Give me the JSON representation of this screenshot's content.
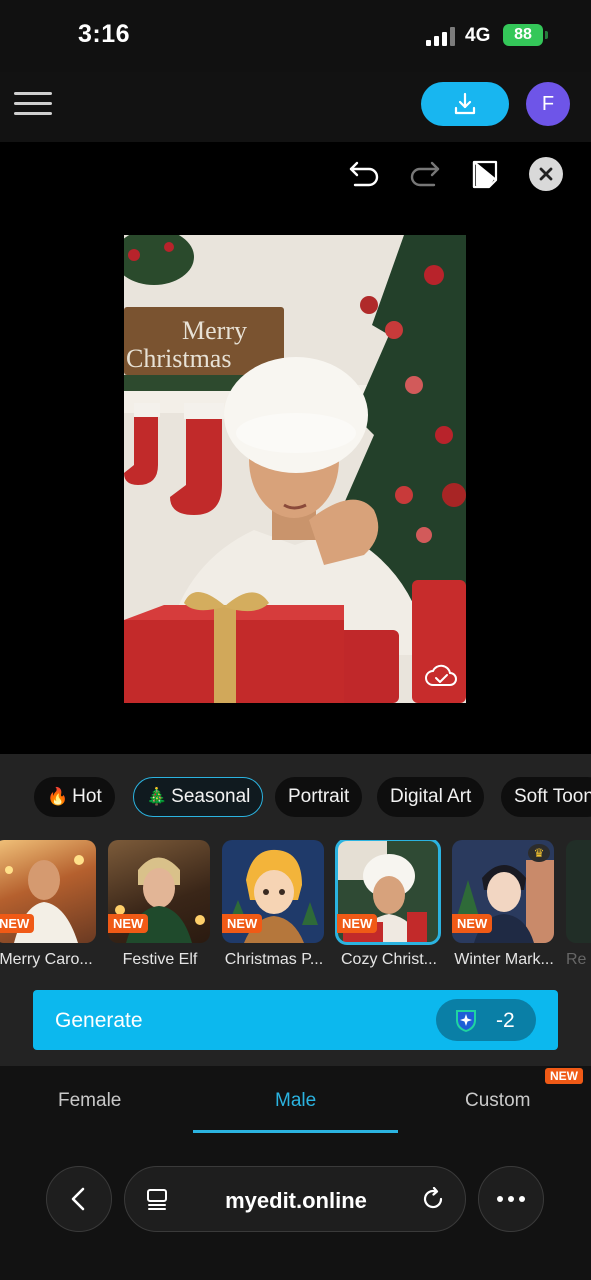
{
  "status_bar": {
    "time": "3:16",
    "network": "4G",
    "battery": "88"
  },
  "header": {
    "download_icon": "download-icon",
    "avatar_letter": "F",
    "colors": {
      "download": "#18b6f0",
      "avatar": "#6e55e8"
    }
  },
  "editor": {
    "tools": [
      "undo-icon",
      "redo-icon",
      "eraser-icon",
      "close-icon"
    ],
    "canvas_text": "Merry Christmas"
  },
  "categories": [
    {
      "emoji": "🔥",
      "label": "Hot"
    },
    {
      "emoji": "🎄",
      "label": "Seasonal",
      "active": true
    },
    {
      "emoji": "",
      "label": "Portrait"
    },
    {
      "emoji": "",
      "label": "Digital Art"
    },
    {
      "emoji": "",
      "label": "Soft Toon"
    }
  ],
  "styles": [
    {
      "label": "Merry Caro...",
      "badge": "NEW"
    },
    {
      "label": "Festive Elf",
      "badge": "NEW"
    },
    {
      "label": "Christmas P...",
      "badge": "NEW"
    },
    {
      "label": "Cozy Christ...",
      "badge": "NEW",
      "selected": true
    },
    {
      "label": "Winter Mark...",
      "badge": "NEW",
      "crown": "♛"
    },
    {
      "label": "Re",
      "badge": ""
    }
  ],
  "generate": {
    "label": "Generate",
    "cost": "-2",
    "cost_icon": "credit-shield-icon"
  },
  "gender_tabs": [
    {
      "label": "Female"
    },
    {
      "label": "Male",
      "active": true
    },
    {
      "label": "Custom",
      "tag": "NEW"
    }
  ],
  "browser": {
    "url": "myedit.online"
  }
}
